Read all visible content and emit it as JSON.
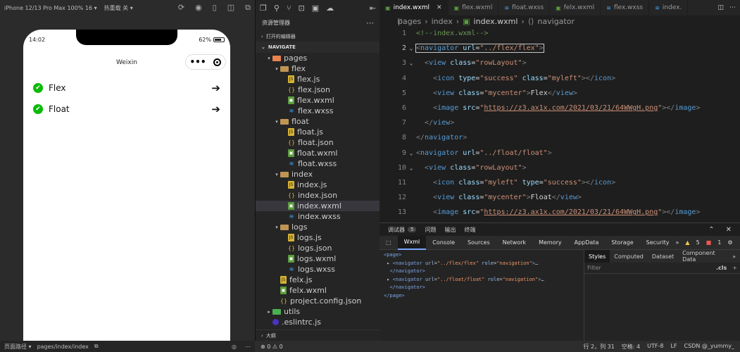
{
  "simulator": {
    "device": "iPhone 12/13 Pro Max 100% 16 ▾",
    "hotreload": "热重载 关 ▾",
    "phone": {
      "time": "14:02",
      "battery": "62%",
      "title": "Weixin",
      "capsule_dots": "•••",
      "items": [
        {
          "label": "Flex"
        },
        {
          "label": "Float"
        }
      ]
    },
    "status": {
      "path_label": "页面路径 ▾",
      "path": "pages/index/index"
    }
  },
  "explorer": {
    "header": "资源管理器",
    "open_editors": "打开的编辑器",
    "project": "NAVIGATE",
    "tree": [
      {
        "label": "pages",
        "type": "pages",
        "depth": 0,
        "open": true
      },
      {
        "label": "flex",
        "type": "folder",
        "depth": 1,
        "open": true
      },
      {
        "label": "flex.js",
        "type": "js",
        "depth": 2
      },
      {
        "label": "flex.json",
        "type": "json",
        "depth": 2
      },
      {
        "label": "flex.wxml",
        "type": "wxml",
        "depth": 2
      },
      {
        "label": "flex.wxss",
        "type": "wxss",
        "depth": 2
      },
      {
        "label": "float",
        "type": "folder",
        "depth": 1,
        "open": true
      },
      {
        "label": "float.js",
        "type": "js",
        "depth": 2
      },
      {
        "label": "float.json",
        "type": "json",
        "depth": 2
      },
      {
        "label": "float.wxml",
        "type": "wxml",
        "depth": 2
      },
      {
        "label": "float.wxss",
        "type": "wxss",
        "depth": 2
      },
      {
        "label": "index",
        "type": "folder",
        "depth": 1,
        "open": true
      },
      {
        "label": "index.js",
        "type": "js",
        "depth": 2
      },
      {
        "label": "index.json",
        "type": "json",
        "depth": 2
      },
      {
        "label": "index.wxml",
        "type": "wxml",
        "depth": 2,
        "selected": true
      },
      {
        "label": "index.wxss",
        "type": "wxss",
        "depth": 2
      },
      {
        "label": "logs",
        "type": "folder",
        "depth": 1,
        "open": true
      },
      {
        "label": "logs.js",
        "type": "js",
        "depth": 2
      },
      {
        "label": "logs.json",
        "type": "json",
        "depth": 2
      },
      {
        "label": "logs.wxml",
        "type": "wxml",
        "depth": 2
      },
      {
        "label": "logs.wxss",
        "type": "wxss",
        "depth": 2
      },
      {
        "label": "felx.js",
        "type": "js",
        "depth": 1
      },
      {
        "label": "felx.wxml",
        "type": "wxml",
        "depth": 1
      },
      {
        "label": "project.config.json",
        "type": "json",
        "depth": 1
      },
      {
        "label": "utils",
        "type": "utils",
        "depth": 0,
        "open": false
      },
      {
        "label": ".eslintrc.js",
        "type": "eslint",
        "depth": 0
      }
    ],
    "outline": "大纲"
  },
  "editor": {
    "tabs": [
      {
        "label": "index.wxml",
        "icon": "wxml",
        "active": true
      },
      {
        "label": "flex.wxml",
        "icon": "wxml"
      },
      {
        "label": "float.wxss",
        "icon": "wxss"
      },
      {
        "label": "felx.wxml",
        "icon": "wxml"
      },
      {
        "label": "flex.wxss",
        "icon": "wxss"
      },
      {
        "label": "index.",
        "icon": "wxss"
      }
    ],
    "breadcrumb": [
      "pages",
      "index",
      "index.wxml",
      "navigator"
    ]
  },
  "devtools": {
    "top_tabs": [
      {
        "label": "调试器",
        "badge": "5"
      },
      {
        "label": "问题"
      },
      {
        "label": "输出"
      },
      {
        "label": "终端"
      }
    ],
    "tabs": [
      "Wxml",
      "Console",
      "Sources",
      "Network",
      "Memory",
      "AppData",
      "Storage",
      "Security"
    ],
    "more": "»",
    "warn_count": "5",
    "err_count": "1",
    "style_tabs": [
      "Styles",
      "Computed",
      "Dataset",
      "Component Data"
    ],
    "filter_placeholder": "Filter",
    "cls": ".cls"
  },
  "statusbar": {
    "errors": "⊗ 0 ⚠ 0",
    "position": "行 2，列 31",
    "spaces": "空格: 4",
    "encoding": "UTF-8",
    "eol": "LF",
    "watermark": "CSDN @_yummy_"
  },
  "colors": {
    "success_green": "#09bb07",
    "selection": "#37373d"
  }
}
